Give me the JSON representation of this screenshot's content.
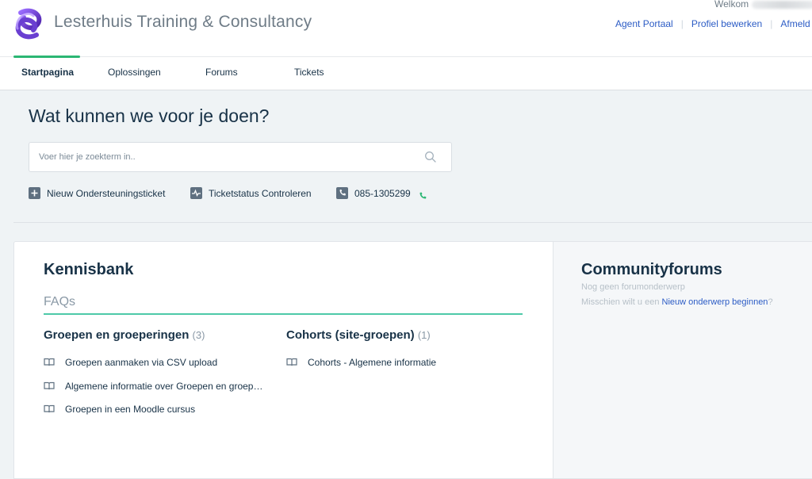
{
  "brand": {
    "name": "Lesterhuis Training & Consultancy",
    "logo_icon": "purple-knot-logo-icon"
  },
  "header": {
    "welcome_label": "Welkom",
    "links": [
      "Agent Portaal",
      "Profiel bewerken",
      "Afmeld"
    ]
  },
  "nav": {
    "tabs": [
      "Startpagina",
      "Oplossingen",
      "Forums",
      "Tickets"
    ],
    "active_tab": "Startpagina",
    "accent_color": "#2bb673"
  },
  "hero": {
    "title": "Wat kunnen we voor je doen?",
    "search_placeholder": "Voer hier je zoekterm in..",
    "actions": {
      "new_ticket": "Nieuw Ondersteuningsticket",
      "ticket_status": "Ticketstatus Controleren",
      "phone": "085-1305299"
    }
  },
  "knowledge_base": {
    "title": "Kennisbank",
    "section": "FAQs",
    "categories": [
      {
        "name": "Groepen en groeperingen",
        "count": "(3)",
        "articles": [
          "Groepen aanmaken via CSV upload",
          "Algemene informatie over Groepen en groep…",
          "Groepen in een Moodle cursus"
        ]
      },
      {
        "name": "Cohorts (site-groepen)",
        "count": "(1)",
        "articles": [
          "Cohorts - Algemene informatie"
        ]
      }
    ]
  },
  "community": {
    "title": "Communityforums",
    "empty_text": "Nog geen forumonderwerp",
    "hint_prefix": "Misschien wilt u een",
    "hint_link": "Nieuw onderwerp beginnen",
    "hint_suffix": "?"
  }
}
